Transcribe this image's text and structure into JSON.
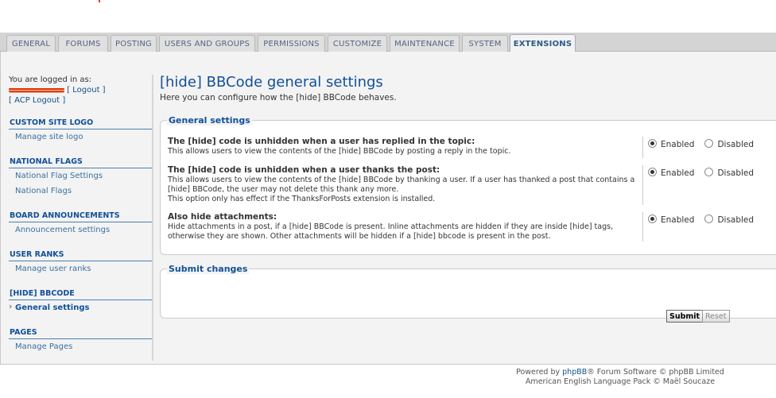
{
  "tabs": [
    {
      "label": "GENERAL",
      "active": false
    },
    {
      "label": "FORUMS",
      "active": false
    },
    {
      "label": "POSTING",
      "active": false
    },
    {
      "label": "USERS AND GROUPS",
      "active": false
    },
    {
      "label": "PERMISSIONS",
      "active": false
    },
    {
      "label": "CUSTOMIZE",
      "active": false
    },
    {
      "label": "MAINTENANCE",
      "active": false
    },
    {
      "label": "SYSTEM",
      "active": false
    },
    {
      "label": "EXTENSIONS",
      "active": true
    }
  ],
  "sidebar": {
    "logged_in_text": "You are logged in as:",
    "logout_label": "[ Logout ]",
    "acp_logout_label": "[ ACP Logout ]",
    "sections": [
      {
        "title": "CUSTOM SITE LOGO",
        "items": [
          {
            "label": "Manage site logo"
          }
        ]
      },
      {
        "title": "NATIONAL FLAGS",
        "items": [
          {
            "label": "National Flag Settings"
          },
          {
            "label": "National Flags"
          }
        ]
      },
      {
        "title": "BOARD ANNOUNCEMENTS",
        "items": [
          {
            "label": "Announcement settings"
          }
        ]
      },
      {
        "title": "USER RANKS",
        "items": [
          {
            "label": "Manage user ranks"
          }
        ]
      },
      {
        "title": "[HIDE] BBCODE",
        "items": [
          {
            "label": "General settings",
            "current": true
          }
        ]
      },
      {
        "title": "PAGES",
        "items": [
          {
            "label": "Manage Pages"
          }
        ]
      }
    ]
  },
  "main": {
    "title": "[hide] BBCode general settings",
    "intro": "Here you can configure how the [hide] BBCode behaves.",
    "general": {
      "legend": "General settings",
      "enabled_label": "Enabled",
      "disabled_label": "Disabled",
      "rows": [
        {
          "title": "The [hide] code is unhidden when a user has replied in the topic:",
          "desc": "This allows users to view the contents of the [hide] BBCode by posting a reply in the topic.",
          "value": "enabled"
        },
        {
          "title": "The [hide] code is unhidden when a user thanks the post:",
          "desc": "This allows users to view the contents of the [hide] BBCode by thanking a user. If a user has thanked a post that contains a [hide] BBCode, the user may not delete this thank any more.",
          "desc2": "This option only has effect if the ThanksForPosts extension is installed.",
          "value": "enabled"
        },
        {
          "title": "Also hide attachments:",
          "desc": "Hide attachments in a post, if a [hide] BBCode is present. Inline attachments are hidden if they are inside [hide] tags, otherwise they are shown. Other attachments will be hidden if a [hide] bbcode is present in the post.",
          "value": "enabled"
        }
      ]
    },
    "submit": {
      "legend": "Submit changes",
      "submit_label": "Submit",
      "reset_label": "Reset"
    }
  },
  "footer": {
    "powered_prefix": "Powered by ",
    "phpbb_link": "phpBB",
    "powered_suffix": "® Forum Software © phpBB Limited",
    "language_pack": "American English Language Pack © Maël Soucaze"
  }
}
